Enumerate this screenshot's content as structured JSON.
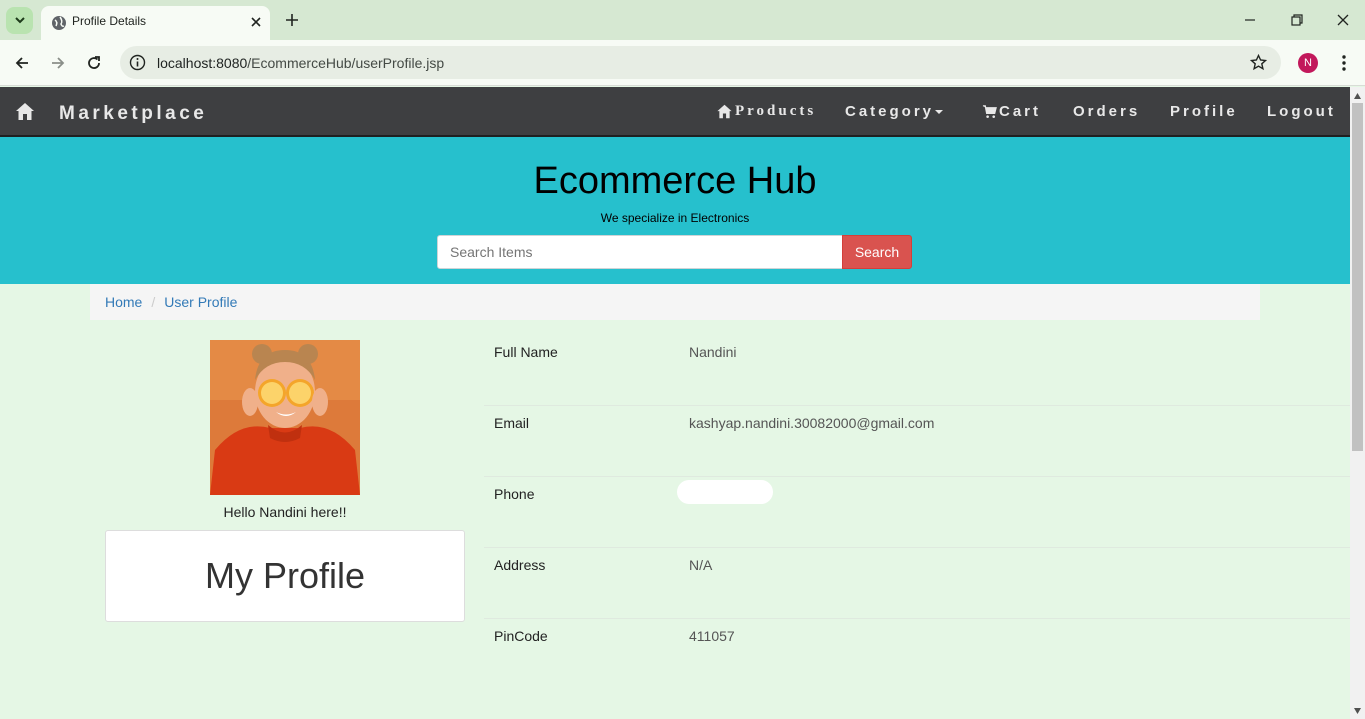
{
  "browser": {
    "tab_title": "Profile Details",
    "url_host": "localhost:8080",
    "url_path": "/EcommerceHub/userProfile.jsp",
    "avatar_initial": "N"
  },
  "navbar": {
    "brand": "Marketplace",
    "links": {
      "products": "Products",
      "category": "Category",
      "cart": "Cart",
      "orders": "Orders",
      "profile": "Profile",
      "logout": "Logout"
    }
  },
  "header": {
    "title": "Ecommerce Hub",
    "tagline": "We specialize in Electronics",
    "search_placeholder": "Search Items",
    "search_button": "Search"
  },
  "breadcrumb": {
    "home": "Home",
    "current": "User Profile"
  },
  "profile": {
    "greeting": "Hello Nandini here!!",
    "heading": "My Profile",
    "fields": [
      {
        "label": "Full Name",
        "value": "Nandini"
      },
      {
        "label": "Email",
        "value": "kashyap.nandini.30082000@gmail.com"
      },
      {
        "label": "Phone",
        "value": ""
      },
      {
        "label": "Address",
        "value": "N/A"
      },
      {
        "label": "PinCode",
        "value": "411057"
      }
    ]
  },
  "colors": {
    "navbar_bg": "#3e3f41",
    "jumbotron_bg": "#26c0cd",
    "page_bg": "#e5f7e5",
    "search_button_bg": "#d9534f",
    "link": "#337ab7"
  },
  "icons": [
    "tab-search-icon",
    "globe-icon",
    "close-icon",
    "plus-icon",
    "minimize-icon",
    "restore-icon",
    "back-arrow-icon",
    "forward-arrow-icon",
    "reload-icon",
    "info-icon",
    "star-icon",
    "kebab-menu-icon",
    "home-icon",
    "cart-icon",
    "caret-down-icon"
  ]
}
